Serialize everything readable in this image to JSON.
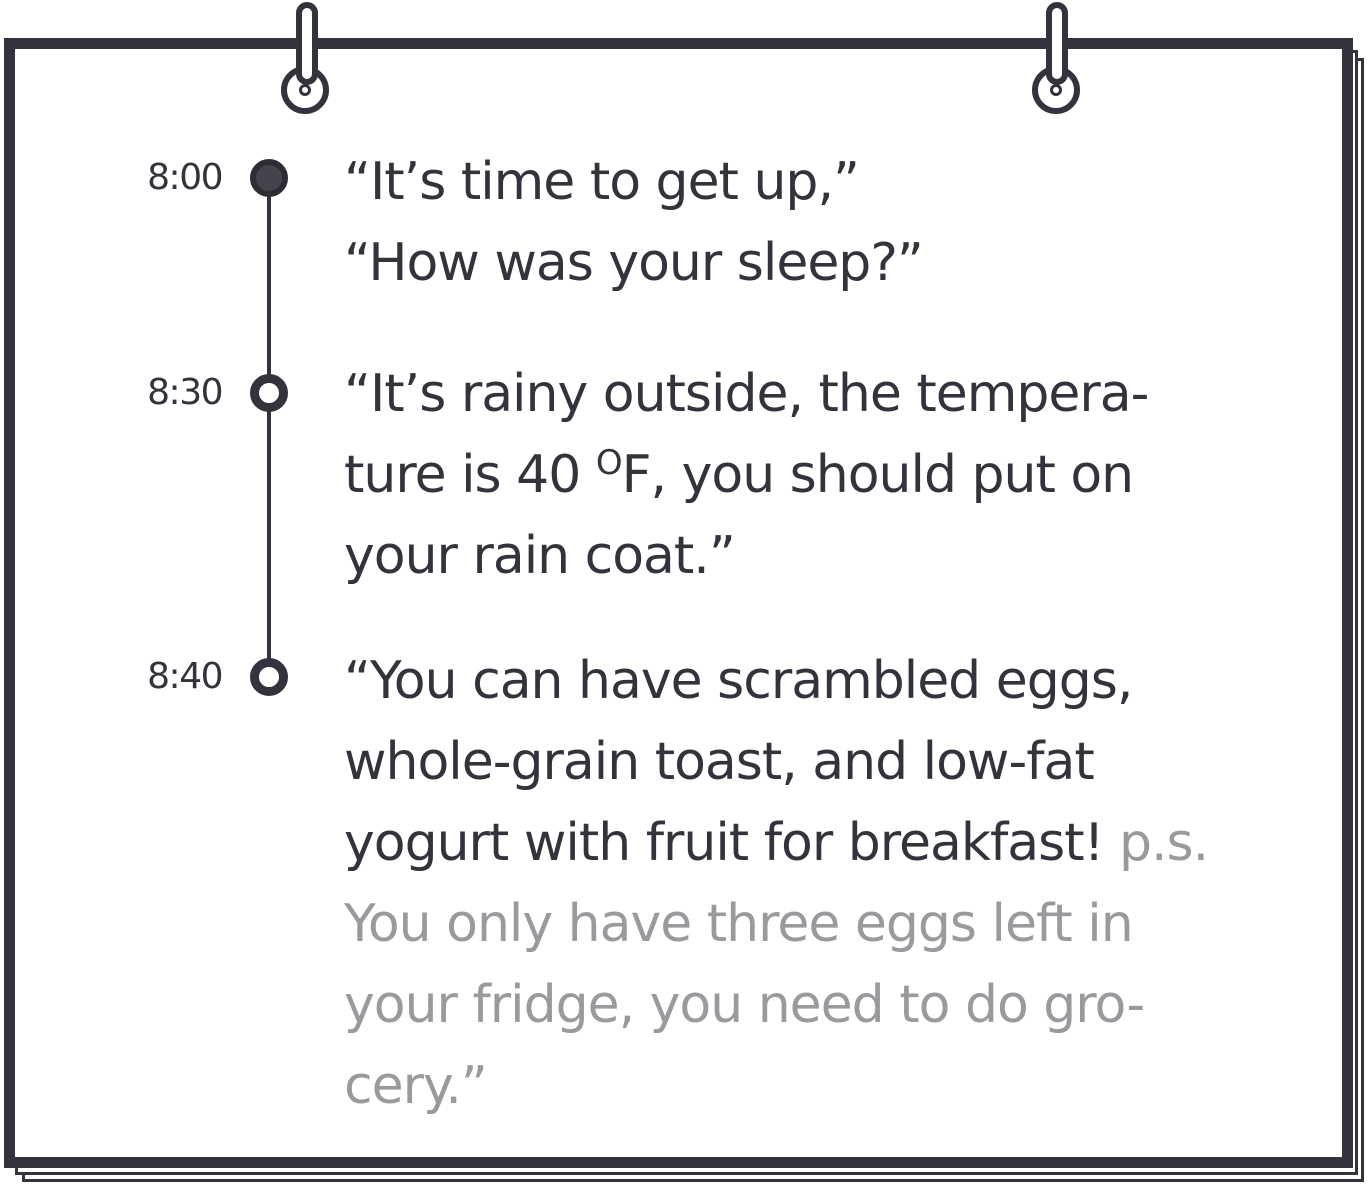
{
  "schedule": [
    {
      "time": "8:00",
      "lines": [
        "“It’s time to get up,”",
        "“How was your sleep?”"
      ]
    },
    {
      "time": "8:30",
      "lines": [
        "“It’s rainy outside, the tempera-",
        "ture is 40 ",
        "O",
        "F,  you should put on",
        "your rain coat.”"
      ]
    },
    {
      "time": "8:40",
      "lines": [
        "“You can have scrambled eggs,",
        "whole-grain toast,  and low-fat",
        "yogurt with fruit for breakfast! "
      ],
      "note_lines": [
        "p.s.",
        "You only have three eggs left in",
        "your fridge, you need to do gro-",
        "cery.”"
      ]
    }
  ],
  "colors": {
    "ink": "#33333d",
    "note": "#9a9a9e",
    "background": "#ffffff"
  }
}
